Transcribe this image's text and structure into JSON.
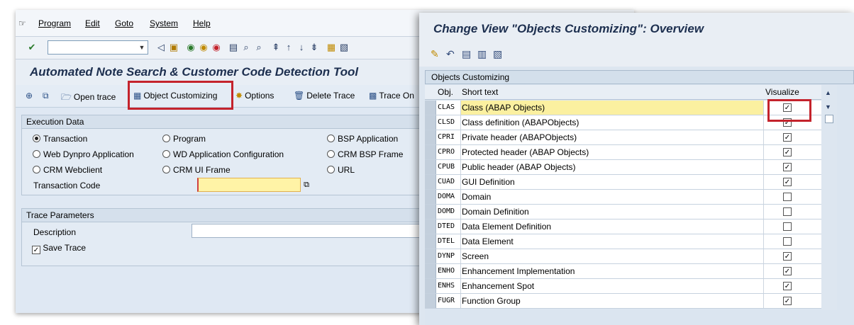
{
  "menu": {
    "items": [
      "Program",
      "Edit",
      "Goto",
      "System",
      "Help"
    ]
  },
  "main": {
    "title": "Automated Note Search & Customer Code Detection Tool",
    "toolbar": {
      "open_trace": "Open trace",
      "object_customizing": "Object Customizing",
      "options": "Options",
      "delete_trace": "Delete Trace",
      "trace_on": "Trace On"
    },
    "execution_data": {
      "title": "Execution Data",
      "radios": [
        {
          "label": "Transaction",
          "selected": true
        },
        {
          "label": "Program",
          "selected": false
        },
        {
          "label": "BSP Application",
          "selected": false
        },
        {
          "label": "Web Dynpro Application",
          "selected": false
        },
        {
          "label": "WD Application Configuration",
          "selected": false
        },
        {
          "label": "CRM BSP Frame",
          "selected": false
        },
        {
          "label": "CRM Webclient",
          "selected": false
        },
        {
          "label": "CRM UI Frame",
          "selected": false
        },
        {
          "label": "URL",
          "selected": false
        }
      ],
      "transaction_code_label": "Transaction Code",
      "transaction_code_value": ""
    },
    "trace_parameters": {
      "title": "Trace Parameters",
      "description_label": "Description",
      "description_value": "",
      "save_trace_label": "Save Trace",
      "save_trace_checked": true
    }
  },
  "dialog": {
    "title": "Change View \"Objects Customizing\": Overview",
    "table_caption": "Objects Customizing",
    "columns": {
      "obj": "Obj.",
      "short_text": "Short text",
      "visualize": "Visualize"
    },
    "rows": [
      {
        "obj": "CLAS",
        "text": "Class (ABAP Objects)",
        "visualize": true,
        "highlighted": true
      },
      {
        "obj": "CLSD",
        "text": "Class definition (ABAPObjects)",
        "visualize": true
      },
      {
        "obj": "CPRI",
        "text": "Private header (ABAPObjects)",
        "visualize": true
      },
      {
        "obj": "CPRO",
        "text": "Protected header (ABAP Objects)",
        "visualize": true
      },
      {
        "obj": "CPUB",
        "text": "Public header (ABAP Objects)",
        "visualize": true
      },
      {
        "obj": "CUAD",
        "text": "GUI Definition",
        "visualize": true
      },
      {
        "obj": "DOMA",
        "text": "Domain",
        "visualize": false
      },
      {
        "obj": "DOMD",
        "text": "Domain Definition",
        "visualize": false
      },
      {
        "obj": "DTED",
        "text": "Data Element Definition",
        "visualize": false
      },
      {
        "obj": "DTEL",
        "text": "Data Element",
        "visualize": false
      },
      {
        "obj": "DYNP",
        "text": "Screen",
        "visualize": true
      },
      {
        "obj": "ENHO",
        "text": "Enhancement Implementation",
        "visualize": true
      },
      {
        "obj": "ENHS",
        "text": "Enhancement Spot",
        "visualize": true
      },
      {
        "obj": "FUGR",
        "text": "Function Group",
        "visualize": true
      }
    ]
  },
  "colors": {
    "highlight_border": "#c4232c",
    "title_text": "#1d2f4f",
    "selected_cell": "#fbf0a0"
  }
}
